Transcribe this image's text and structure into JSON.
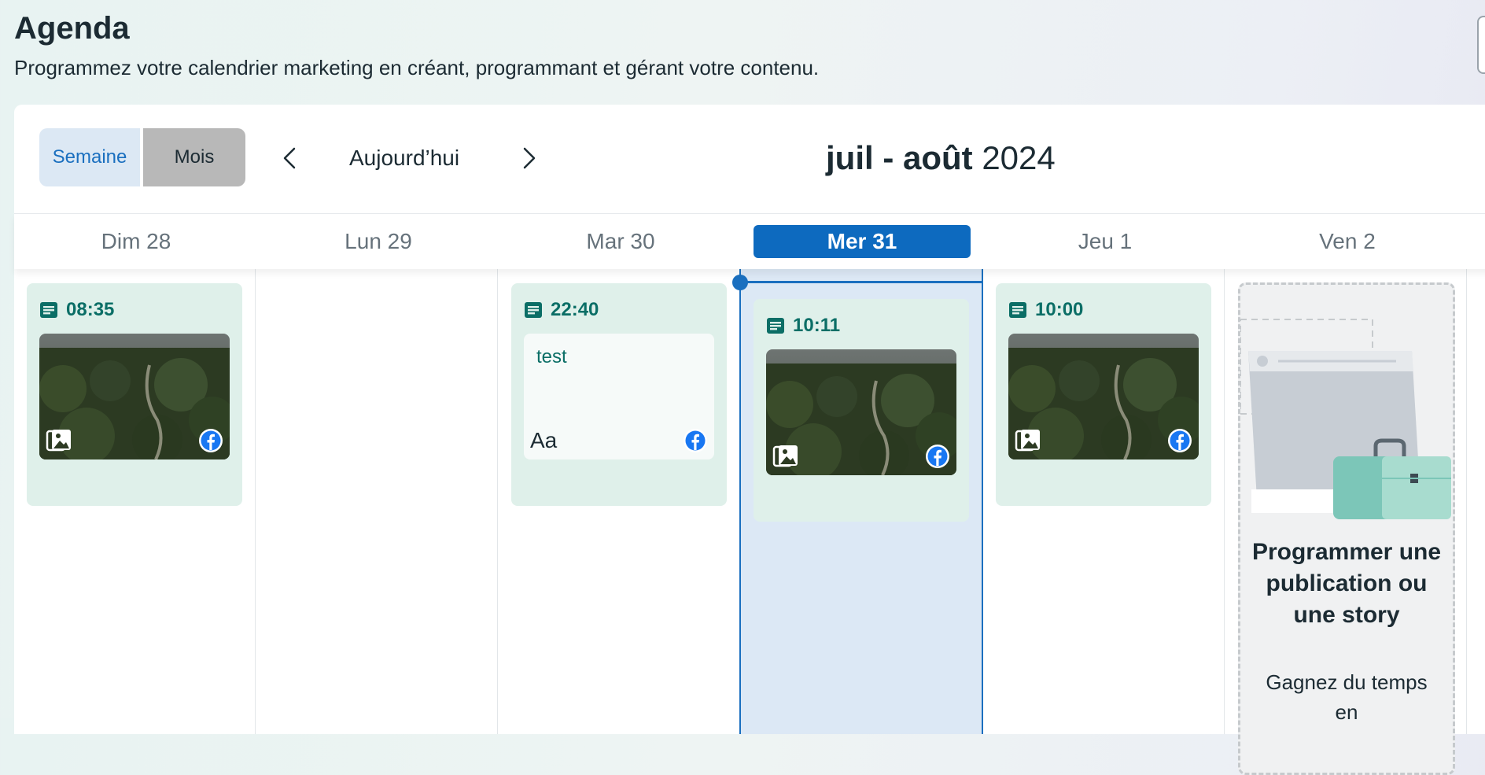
{
  "header": {
    "title": "Agenda",
    "subtitle": "Programmez votre calendrier marketing en créant, programmant et gérant votre contenu."
  },
  "toolbar": {
    "view_week": "Semaine",
    "view_month": "Mois",
    "today": "Aujourd’hui",
    "range_bold": "juil - août",
    "range_year": "2024",
    "prev_icon": "chevron-left-icon",
    "next_icon": "chevron-right-icon"
  },
  "days": [
    {
      "label": "Dim 28",
      "today": false
    },
    {
      "label": "Lun 29",
      "today": false
    },
    {
      "label": "Mar 30",
      "today": false
    },
    {
      "label": "Mer 31",
      "today": true
    },
    {
      "label": "Jeu 1",
      "today": false
    },
    {
      "label": "Ven 2",
      "today": false
    }
  ],
  "posts": [
    {
      "day": "Dim 28",
      "time": "08:35",
      "type": "image",
      "platform": "facebook"
    },
    {
      "day": "Mar 30",
      "time": "22:40",
      "type": "text",
      "text": "test",
      "text_icon": "Aa",
      "platform": "facebook"
    },
    {
      "day": "Mer 31",
      "time": "10:11",
      "type": "image",
      "platform": "facebook"
    },
    {
      "day": "Jeu 1",
      "time": "10:00",
      "type": "image",
      "platform": "facebook"
    }
  ],
  "promo": {
    "title": "Programmer une publication ou une story",
    "description": "Gagnez du temps en"
  },
  "colors": {
    "accent": "#1a6fbf",
    "post_bg": "#dff0ea",
    "post_time": "#0b6e66",
    "facebook": "#1877f2"
  }
}
